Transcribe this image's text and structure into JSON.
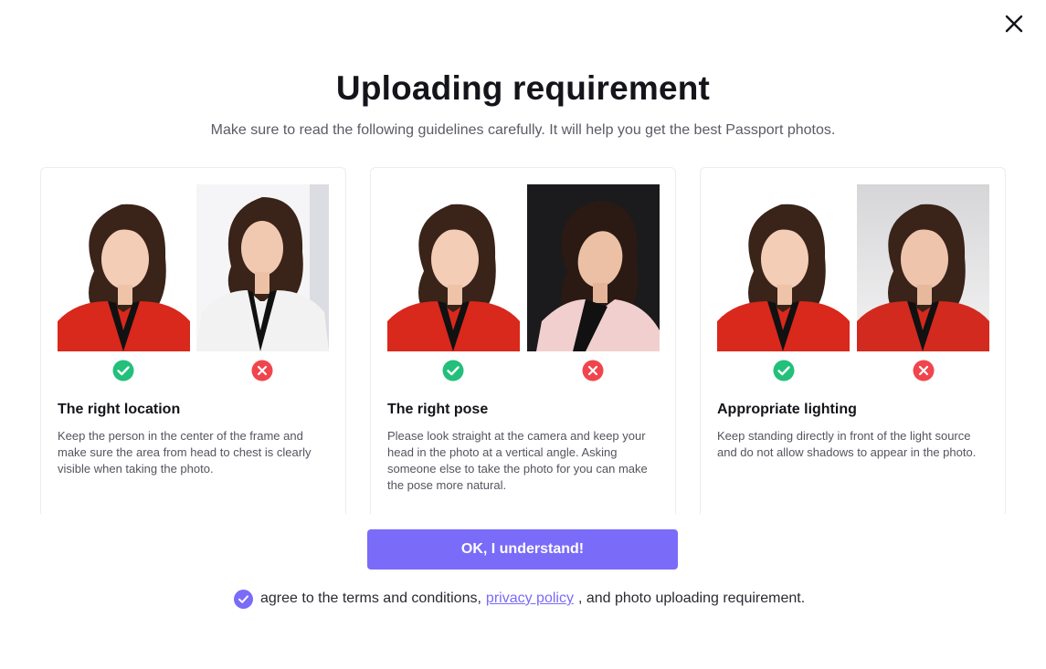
{
  "dialog": {
    "title": "Uploading requirement",
    "subtitle": "Make sure to read the following guidelines carefully. It will help you get the best Passport photos."
  },
  "cards": [
    {
      "title": "The right location",
      "description": "Keep the person in the center of the frame and make sure the area from head to chest is clearly visible when taking the photo.",
      "good_icon": "check-circle-icon",
      "bad_icon": "x-circle-icon"
    },
    {
      "title": "The right pose",
      "description": "Please look straight at the camera and keep your head in the photo at a vertical angle. Asking someone else to take the photo for you can make the pose more natural.",
      "good_icon": "check-circle-icon",
      "bad_icon": "x-circle-icon"
    },
    {
      "title": "Appropriate lighting",
      "description": "Keep standing directly in front of the light source and do not allow shadows to appear in the photo.",
      "good_icon": "check-circle-icon",
      "bad_icon": "x-circle-icon"
    }
  ],
  "actions": {
    "ok_label": "OK, I understand!"
  },
  "agreement": {
    "checked": true,
    "prefix": "agree to the terms and conditions,",
    "link": "privacy policy",
    "suffix": ", and photo uploading requirement."
  },
  "colors": {
    "accent": "#7a6bf9",
    "good": "#22c07a",
    "bad": "#f0454d",
    "blazer_red": "#d9281c"
  }
}
